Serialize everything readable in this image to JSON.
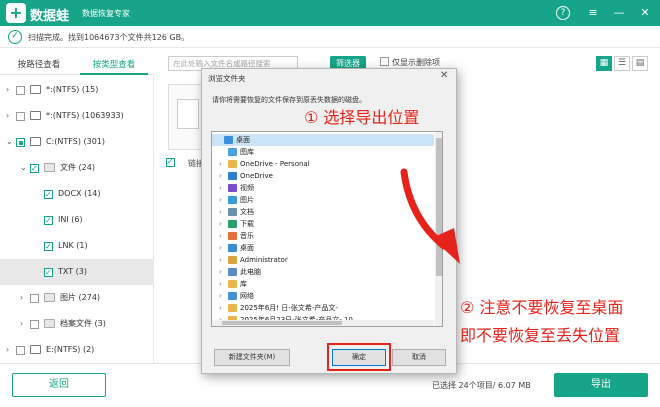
{
  "titlebar": {
    "logo": "+",
    "app_name": "数据蛙",
    "app_sub": "数据恢复专家",
    "buttons": [
      "?",
      "≡",
      "—",
      "✕"
    ]
  },
  "scan": {
    "icon": "✓",
    "text": "扫描完成。找到1064673个文件共126 GB。"
  },
  "tabs": {
    "path": "按路径查看",
    "type": "按类型查看"
  },
  "tree": [
    {
      "label": "*:(NTFS) (15)",
      "arrow": "›",
      "check": "none",
      "icon": "drive"
    },
    {
      "label": "*:(NTFS) (1063933)",
      "arrow": "›",
      "check": "none",
      "icon": "drive"
    },
    {
      "label": "C:(NTFS) (301)",
      "arrow": "⌄",
      "check": "part",
      "icon": "drive"
    },
    {
      "label": "文件 (24)",
      "arrow": "⌄",
      "check": "on",
      "icon": "file"
    },
    {
      "label": "DOCX (14)",
      "arrow": "",
      "check": "on",
      "icon": "none"
    },
    {
      "label": "INI (6)",
      "arrow": "",
      "check": "on",
      "icon": "none"
    },
    {
      "label": "LNK (1)",
      "arrow": "",
      "check": "on",
      "icon": "none"
    },
    {
      "label": "TXT (3)",
      "arrow": "",
      "check": "on",
      "icon": "none",
      "selected": true
    },
    {
      "label": "图片 (274)",
      "arrow": "›",
      "check": "none",
      "icon": "image"
    },
    {
      "label": "档案文件 (3)",
      "arrow": "›",
      "check": "none",
      "icon": "archive"
    },
    {
      "label": "E:(NTFS) (2)",
      "arrow": "›",
      "check": "none",
      "icon": "drive"
    }
  ],
  "toolbar": {
    "search_placeholder": "在此处输入文件名或路径搜索",
    "filter": "筛选器",
    "only_deleted": "仅显示删除项",
    "view_icons": [
      "▦",
      "☰",
      "▤"
    ]
  },
  "file_card": {
    "name": "链接"
  },
  "bottom": {
    "back": "返回",
    "selection": "已选择 24个项目/ 6.07 MB",
    "export": "导出"
  },
  "dialog": {
    "title": "浏览文件夹",
    "close": "✕",
    "desc": "请你将需要恢复的文件保存到原丢失数据的磁盘。",
    "items": [
      {
        "label": "桌面",
        "indent": 0,
        "arrow": "",
        "icon_color": "#3b8fd9",
        "selected": true
      },
      {
        "label": "图库",
        "indent": 1,
        "arrow": "",
        "icon_color": "#4aa3e0"
      },
      {
        "label": "OneDrive - Personal",
        "indent": 1,
        "arrow": "›",
        "icon_color": "#e8b64c"
      },
      {
        "label": "OneDrive",
        "indent": 1,
        "arrow": "›",
        "icon_color": "#2f7fd1"
      },
      {
        "label": "视频",
        "indent": 1,
        "arrow": "›",
        "icon_color": "#7b4bd1"
      },
      {
        "label": "图片",
        "indent": 1,
        "arrow": "›",
        "icon_color": "#3ba0d9"
      },
      {
        "label": "文档",
        "indent": 1,
        "arrow": "›",
        "icon_color": "#6c8fb0"
      },
      {
        "label": "下载",
        "indent": 1,
        "arrow": "›",
        "icon_color": "#2aa06d"
      },
      {
        "label": "音乐",
        "indent": 1,
        "arrow": "›",
        "icon_color": "#e0703c"
      },
      {
        "label": "桌面",
        "indent": 1,
        "arrow": "›",
        "icon_color": "#3b8fd9"
      },
      {
        "label": "Administrator",
        "indent": 1,
        "arrow": "›",
        "icon_color": "#d9a441"
      },
      {
        "label": "此电脑",
        "indent": 1,
        "arrow": "›",
        "icon_color": "#5b8cc4"
      },
      {
        "label": "库",
        "indent": 1,
        "arrow": "›",
        "icon_color": "#e8b64c"
      },
      {
        "label": "网络",
        "indent": 1,
        "arrow": "›",
        "icon_color": "#4a8ed8"
      },
      {
        "label": "2025年6月! 日-张文希-产品文-",
        "indent": 1,
        "arrow": "›",
        "icon_color": "#e8b64c"
      },
      {
        "label": "2025年6月23日-张文希-产品文- 10",
        "indent": 1,
        "arrow": "›",
        "icon_color": "#e8b64c"
      }
    ],
    "new_folder": "新建文件夹(M)",
    "ok": "确定",
    "cancel": "取消"
  },
  "annotations": {
    "step1": "① 选择导出位置",
    "step2": "② 注意不要恢复至桌面",
    "step2b": "即不要恢复至丢失位置",
    "color": "#e5231b"
  },
  "colors": {
    "accent": "#16a589"
  }
}
